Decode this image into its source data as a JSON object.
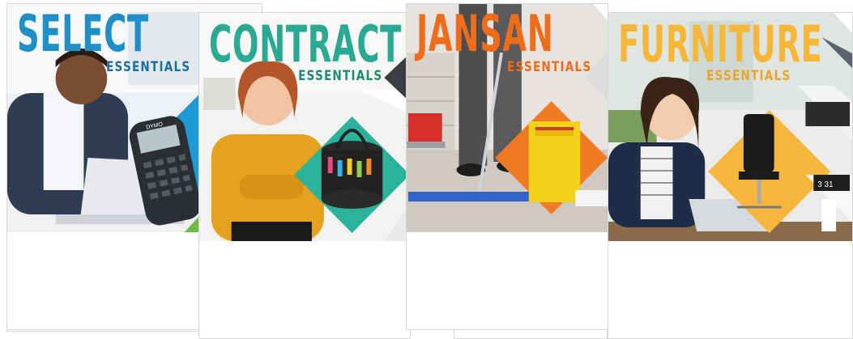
{
  "cards": [
    {
      "title": "SELECT",
      "subtitle": "ESSENTIALS",
      "title_color": "#1f8fc8",
      "subtitle_color": "#1b6fa0",
      "accent": "#1e9ad6"
    },
    {
      "title": "CONTRACT",
      "subtitle": "ESSENTIALS",
      "title_color": "#2aaa92",
      "subtitle_color": "#1f8a77",
      "accent": "#2bb39a"
    },
    {
      "title": "JANSAN",
      "subtitle": "ESSENTIALS",
      "title_color": "#ef6c1a",
      "subtitle_color": "#ef6c1a",
      "accent": "#f07a22"
    },
    {
      "title": "FURNITURE",
      "subtitle": "ESSENTIALS",
      "title_color": "#f6b637",
      "subtitle_color": "#e8a52a",
      "accent": "#f8b63c"
    }
  ],
  "product_labels": {
    "label_maker": "DYMO",
    "clock": "3 31"
  }
}
